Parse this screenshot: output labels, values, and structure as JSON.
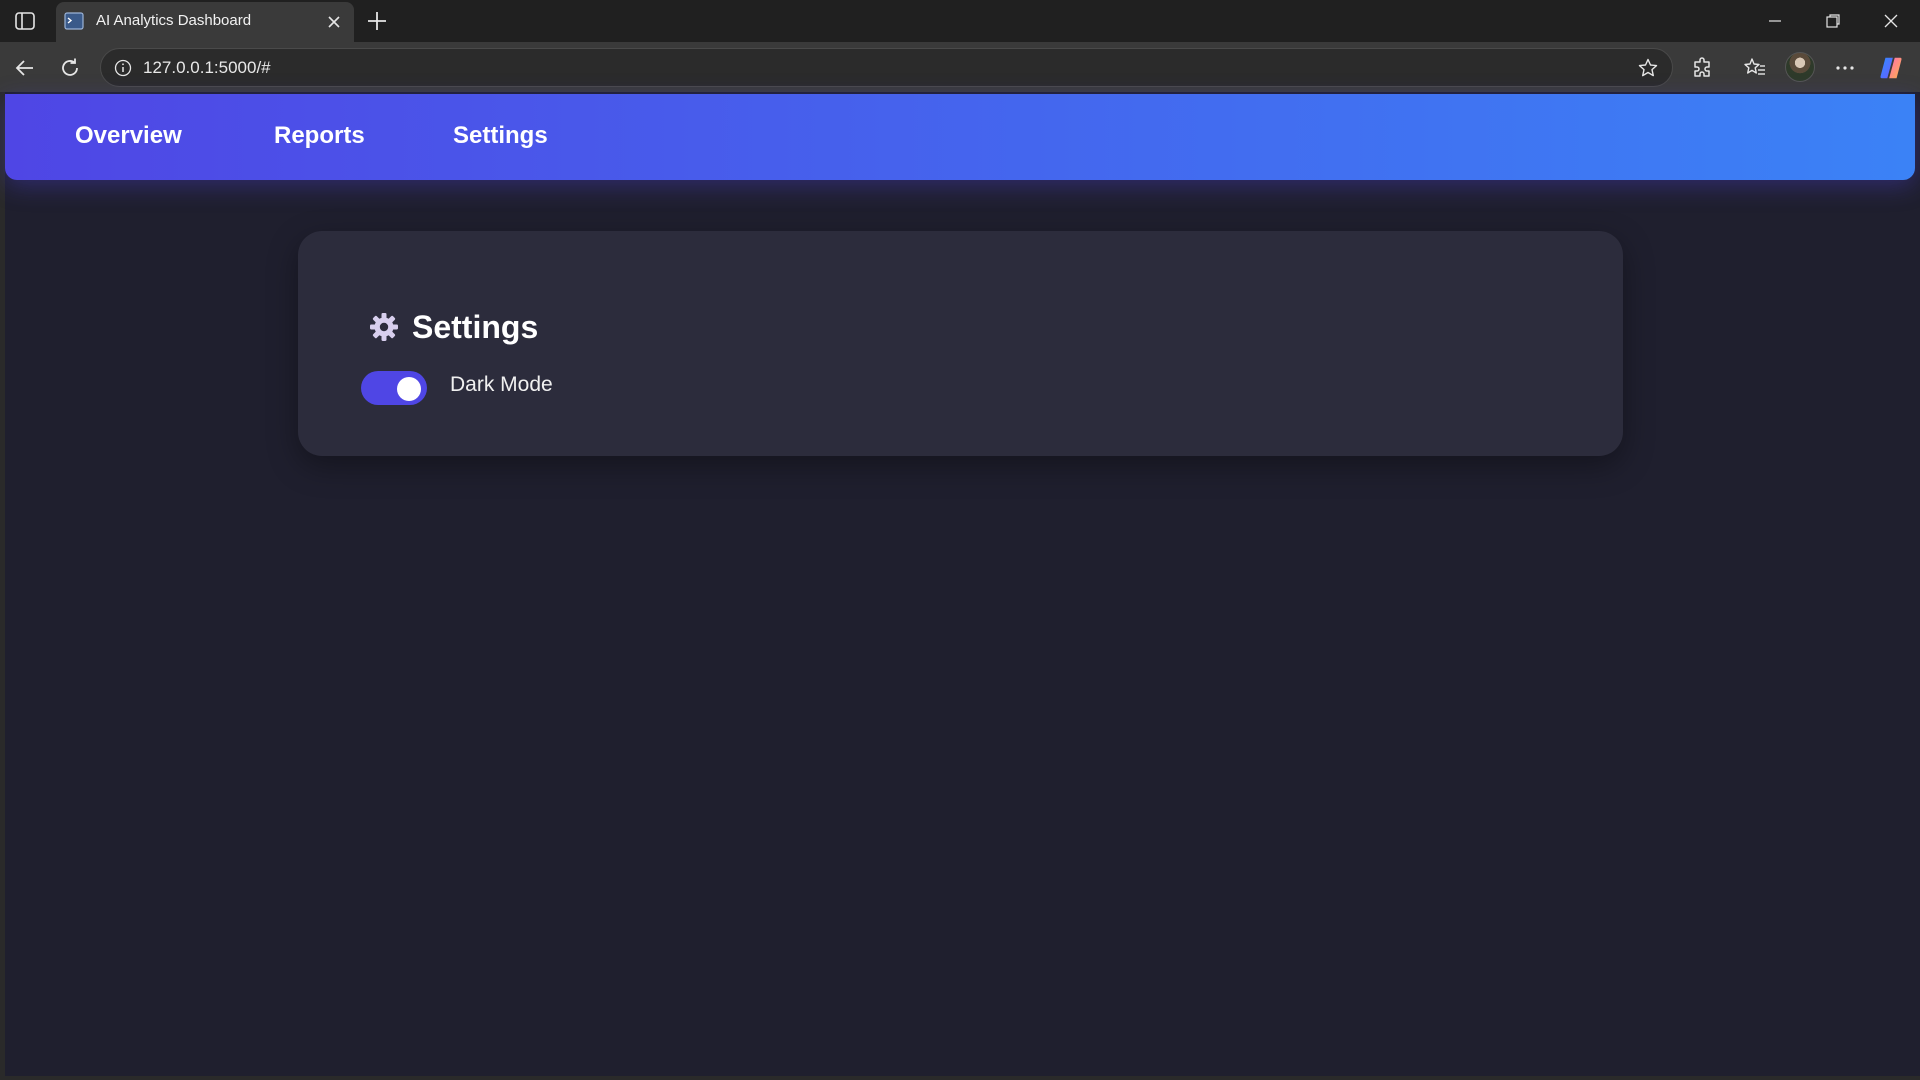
{
  "browser": {
    "tab_title": "AI Analytics Dashboard",
    "url": "127.0.0.1:5000/#"
  },
  "icons": {
    "sidebar_toggle": "sidebar-toggle-icon",
    "favicon": "terminal-favicon-icon",
    "tab_close": "close-icon",
    "new_tab": "plus-icon",
    "window_minimize": "minimize-icon",
    "window_maximize": "restore-icon",
    "window_close": "close-icon",
    "back": "arrow-left-icon",
    "refresh": "refresh-icon",
    "site_info": "info-icon",
    "favorite": "star-icon",
    "extensions": "puzzle-icon",
    "favorites": "favorites-icon",
    "more": "more-icon",
    "copilot": "copilot-icon",
    "settings_heading": "gear-icon"
  },
  "navbar": {
    "links": [
      "Overview",
      "Reports",
      "Settings"
    ],
    "gradient_start": "#4f46e5",
    "gradient_end": "#3b82f6"
  },
  "settings_card": {
    "title": "Settings",
    "dark_mode": {
      "label": "Dark Mode",
      "enabled": true,
      "accent": "#4f46e5"
    }
  },
  "colors": {
    "page_background": "#1f1f2e",
    "card_background": "#2c2c3c"
  }
}
